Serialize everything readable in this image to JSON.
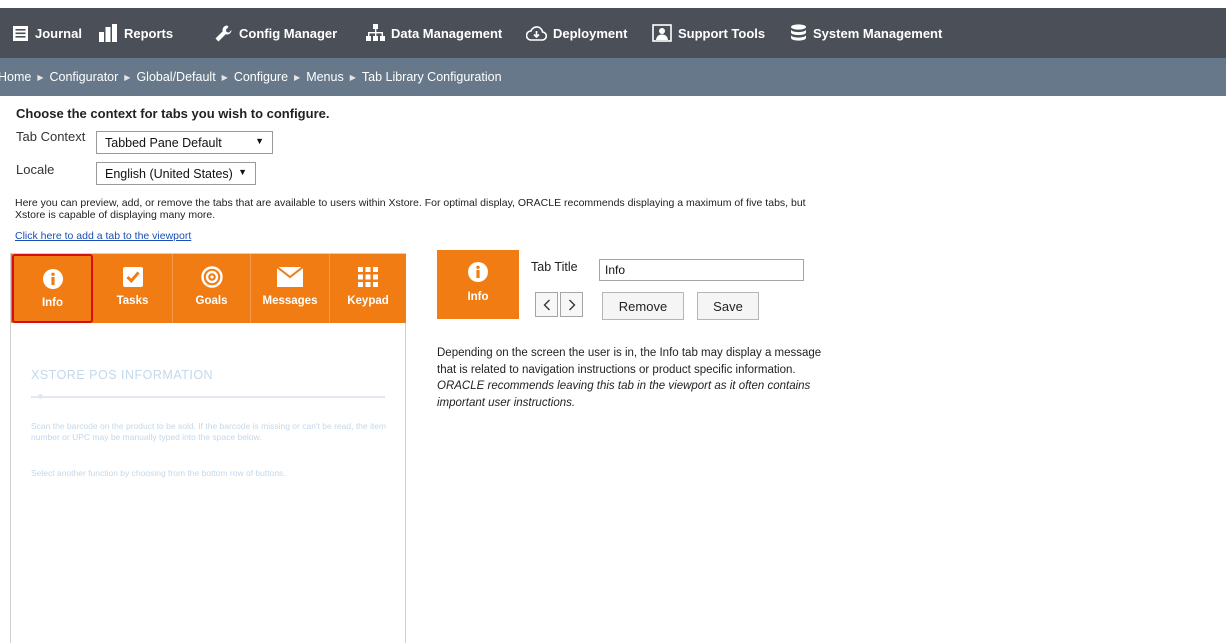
{
  "nav": {
    "items": [
      {
        "label": "Journal",
        "icon": "journal-icon"
      },
      {
        "label": "Reports",
        "icon": "bar-chart-icon"
      },
      {
        "label": "Config Manager",
        "icon": "wrench-icon"
      },
      {
        "label": "Data Management",
        "icon": "hierarchy-icon"
      },
      {
        "label": "Deployment",
        "icon": "cloud-download-icon"
      },
      {
        "label": "Support Tools",
        "icon": "support-icon"
      },
      {
        "label": "System Management",
        "icon": "database-icon"
      }
    ]
  },
  "breadcrumb": {
    "items": [
      "Home",
      "Configurator",
      "Global/Default",
      "Configure",
      "Menus",
      "Tab Library Configuration"
    ],
    "separator": "▶"
  },
  "context": {
    "heading": "Choose the context for tabs you wish to configure.",
    "tab_context_label": "Tab Context",
    "tab_context_value": "Tabbed Pane Default",
    "locale_label": "Locale",
    "locale_value": "English (United States)"
  },
  "intro": {
    "text": "Here you can preview, add, or remove the tabs that are available to users within Xstore. For optimal display, ORACLE recommends displaying a maximum of five tabs, but Xstore is capable of displaying many more.",
    "add_link": "Click here to add a tab to the viewport"
  },
  "viewport": {
    "tabs": [
      {
        "label": "Info",
        "icon": "info-icon",
        "active": true
      },
      {
        "label": "Tasks",
        "icon": "checkbox-icon",
        "active": false
      },
      {
        "label": "Goals",
        "icon": "target-icon",
        "active": false
      },
      {
        "label": "Messages",
        "icon": "envelope-icon",
        "active": false
      },
      {
        "label": "Keypad",
        "icon": "keypad-icon",
        "active": false
      }
    ],
    "content_title": "XSTORE POS INFORMATION",
    "content_para1": "Scan the barcode on the product to be sold. If the barcode is missing or can't be read, the item number or UPC may be manually typed into the space below.",
    "content_para2": "Select another function by choosing from the bottom row of buttons."
  },
  "editor": {
    "preview_label": "Info",
    "tab_title_label": "Tab Title",
    "tab_title_value": "Info",
    "remove_label": "Remove",
    "save_label": "Save",
    "description": "Depending on the screen the user is in, the Info tab may display a message that is related to navigation instructions or product specific information.",
    "recommendation": "ORACLE recommends leaving this tab in the viewport as it often contains important user instructions."
  },
  "colors": {
    "topbar": "#4a4f58",
    "breadcrumb": "#66788a",
    "tab_orange": "#f07c13",
    "active_border": "#d40f0f",
    "link": "#1a4fb5"
  }
}
